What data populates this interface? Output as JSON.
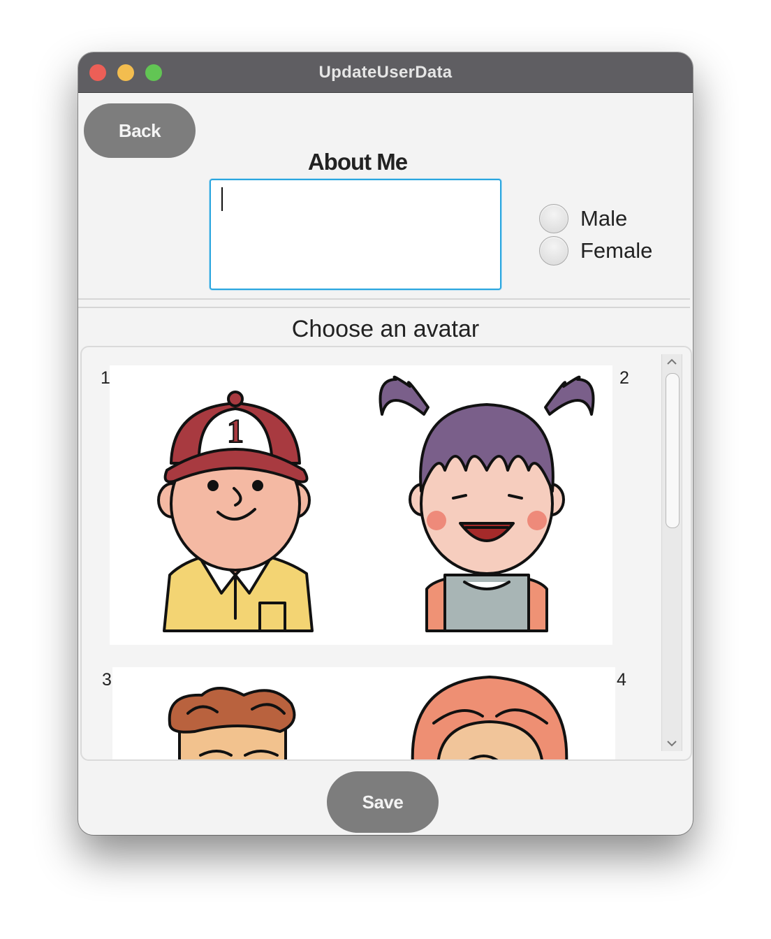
{
  "window": {
    "title": "UpdateUserData"
  },
  "buttons": {
    "back": "Back",
    "save": "Save"
  },
  "about": {
    "label": "About Me",
    "value": ""
  },
  "gender": {
    "options": [
      "Male",
      "Female"
    ]
  },
  "avatars": {
    "heading": "Choose an avatar",
    "items": [
      {
        "number": "1"
      },
      {
        "number": "2"
      },
      {
        "number": "3"
      },
      {
        "number": "4"
      }
    ]
  }
}
